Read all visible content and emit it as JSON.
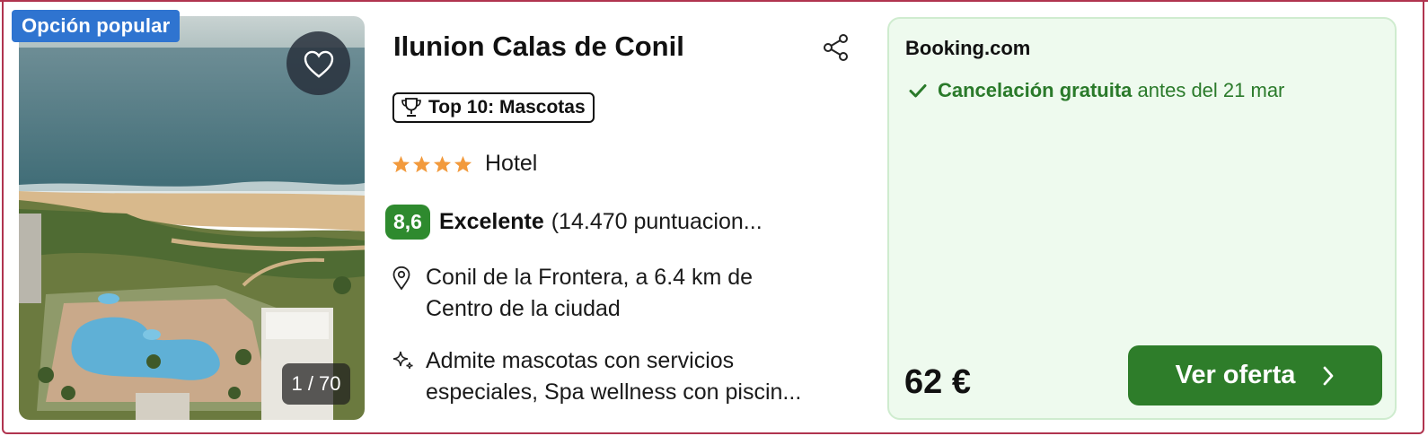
{
  "listing": {
    "badge": "Opción popular",
    "photo_counter": "1 / 70",
    "hotel_name": "Ilunion Calas de Conil",
    "award": "Top 10: Mascotas",
    "stars": 4,
    "hotel_type": "Hotel",
    "rating_score": "8,6",
    "rating_word": "Excelente",
    "rating_count": "(14.470 puntuacion...",
    "location_line1": "Conil de la Frontera, a 6.4 km de",
    "location_line2": "Centro de la ciudad",
    "amenities_line1": "Admite mascotas con servicios",
    "amenities_line2": "especiales, Spa wellness con piscin..."
  },
  "offer": {
    "provider": "Booking.com",
    "cancel_strong": "Cancelación gratuita",
    "cancel_rest": "antes del 21 mar",
    "price": "62 €",
    "cta_label": "Ver oferta"
  },
  "colors": {
    "badge_blue": "#2f74d0",
    "rating_green": "#2e8a2e",
    "cta_green": "#2e7d2a",
    "offer_bg": "#eefaee",
    "star_orange": "#f29a3d",
    "card_border": "#b0344f"
  },
  "icons": [
    "heart-icon",
    "share-icon",
    "trophy-icon",
    "star-icon",
    "location-pin-icon",
    "sparkle-icon",
    "check-icon",
    "chevron-right-icon"
  ]
}
